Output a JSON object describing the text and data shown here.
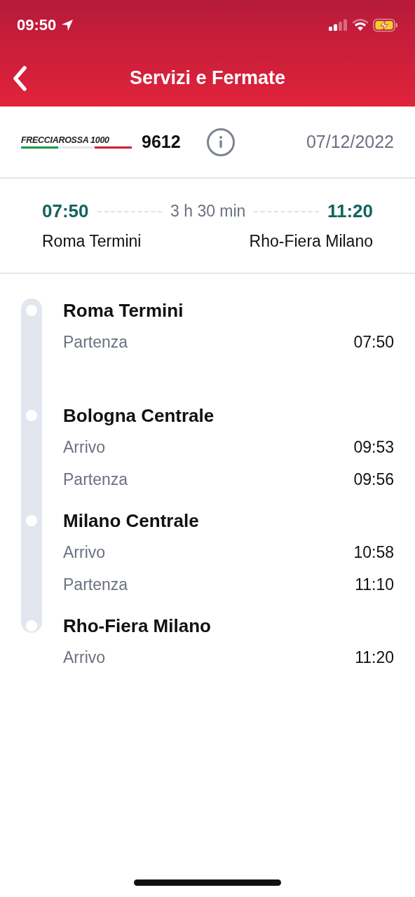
{
  "status_bar": {
    "time": "09:50"
  },
  "header": {
    "title": "Servizi e Fermate"
  },
  "train": {
    "brand": "FRECCIAROSSA 1000",
    "number": "9612",
    "date": "07/12/2022"
  },
  "journey": {
    "departure_time": "07:50",
    "duration": "3 h 30 min",
    "arrival_time": "11:20",
    "origin": "Roma Termini",
    "destination": "Rho-Fiera Milano"
  },
  "stops": [
    {
      "name": "Roma Termini",
      "events": [
        {
          "label": "Partenza",
          "time": "07:50"
        }
      ]
    },
    {
      "name": "Bologna Centrale",
      "events": [
        {
          "label": "Arrivo",
          "time": "09:53"
        },
        {
          "label": "Partenza",
          "time": "09:56"
        }
      ]
    },
    {
      "name": "Milano Centrale",
      "events": [
        {
          "label": "Arrivo",
          "time": "10:58"
        },
        {
          "label": "Partenza",
          "time": "11:10"
        }
      ]
    },
    {
      "name": "Rho-Fiera Milano",
      "events": [
        {
          "label": "Arrivo",
          "time": "11:20"
        }
      ]
    }
  ]
}
